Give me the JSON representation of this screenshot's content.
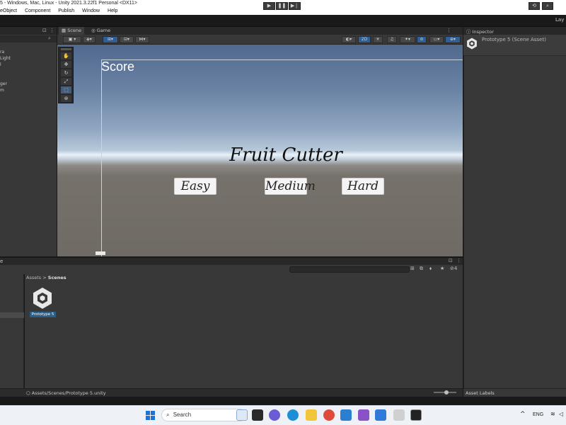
{
  "window": {
    "title": "5 - Windows, Mac, Linux - Unity 2021.3.22f1 Personal <DX11>"
  },
  "menu": [
    "eObject",
    "Component",
    "Publish",
    "Window",
    "Help"
  ],
  "toolbar": {
    "play_icon": "▶",
    "pause_icon": "❚❚",
    "step_icon": "▶❘",
    "layers_label": "Lay"
  },
  "hierarchy": {
    "items": [
      "ra",
      "Light",
      "l",
      "",
      "ger",
      "m"
    ]
  },
  "scene_panel": {
    "tabs": [
      "Scene",
      "Game"
    ],
    "toggle_2d": "2D"
  },
  "game_ui": {
    "score_label": "Score",
    "title": "Fruit Cutter",
    "buttons": [
      "Easy",
      "Medium",
      "Hard"
    ]
  },
  "project": {
    "tab_label": "e",
    "breadcrumb_root": "Assets",
    "breadcrumb_separator": ">",
    "breadcrumb_current": "Scenes",
    "asset_name": "Prototype 5",
    "status_path": "Assets/Scenes/Prototype 5.unity",
    "hidden_count": "4"
  },
  "inspector": {
    "tab_label": "Inspector",
    "asset_title": "Prototype 5 (Scene Asset)",
    "footer_label": "Asset Labels"
  },
  "taskbar": {
    "search_placeholder": "Search",
    "language": "ENG"
  },
  "colors": {
    "selection_blue": "#2c5d87",
    "editor_dark": "#383838",
    "sky_top": "#50698d",
    "ground": "#6f6a64"
  }
}
